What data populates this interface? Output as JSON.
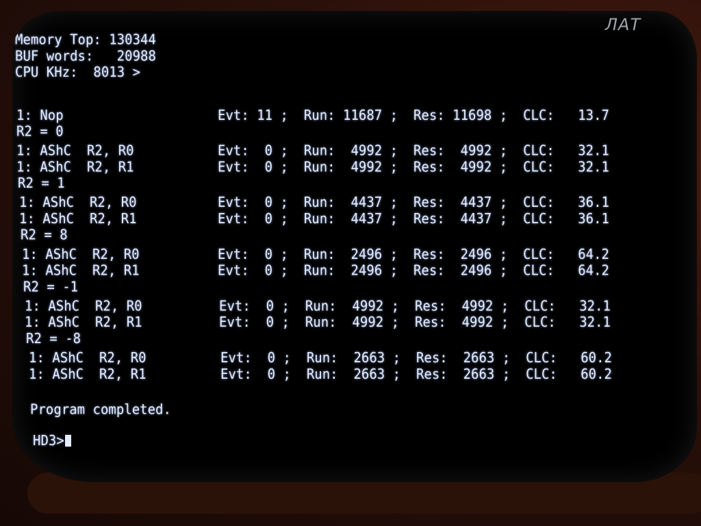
{
  "brand_logo": "ЛАТ",
  "header": {
    "line1": "Memory Top: 130344",
    "line2": "BUF words:   20988",
    "line3": "CPU KHz:  8013 >"
  },
  "rows": [
    {
      "label": "1: Nop",
      "stats": "Evt: 11 ;  Run: 11687 ;  Res: 11698 ;  CLC:   13.7"
    },
    {
      "label": "R2 = 0",
      "stats": ""
    },
    {
      "label": "1: AShC  R2, R0",
      "stats": "Evt:  0 ;  Run:  4992 ;  Res:  4992 ;  CLC:   32.1"
    },
    {
      "label": "1: AShC  R2, R1",
      "stats": "Evt:  0 ;  Run:  4992 ;  Res:  4992 ;  CLC:   32.1"
    },
    {
      "label": "R2 = 1",
      "stats": ""
    },
    {
      "label": "1: AShC  R2, R0",
      "stats": "Evt:  0 ;  Run:  4437 ;  Res:  4437 ;  CLC:   36.1"
    },
    {
      "label": "1: AShC  R2, R1",
      "stats": "Evt:  0 ;  Run:  4437 ;  Res:  4437 ;  CLC:   36.1"
    },
    {
      "label": "R2 = 8",
      "stats": ""
    },
    {
      "label": "1: AShC  R2, R0",
      "stats": "Evt:  0 ;  Run:  2496 ;  Res:  2496 ;  CLC:   64.2"
    },
    {
      "label": "1: AShC  R2, R1",
      "stats": "Evt:  0 ;  Run:  2496 ;  Res:  2496 ;  CLC:   64.2"
    },
    {
      "label": "R2 = -1",
      "stats": ""
    },
    {
      "label": "1: AShC  R2, R0",
      "stats": "Evt:  0 ;  Run:  4992 ;  Res:  4992 ;  CLC:   32.1"
    },
    {
      "label": "1: AShC  R2, R1",
      "stats": "Evt:  0 ;  Run:  4992 ;  Res:  4992 ;  CLC:   32.1"
    },
    {
      "label": "R2 = -8",
      "stats": ""
    },
    {
      "label": "1: AShC  R2, R0",
      "stats": "Evt:  0 ;  Run:  2663 ;  Res:  2663 ;  CLC:   60.2"
    },
    {
      "label": "1: AShC  R2, R1",
      "stats": "Evt:  0 ;  Run:  2663 ;  Res:  2663 ;  CLC:   60.2"
    }
  ],
  "completion_message": "Program completed.",
  "prompt": "HD3>"
}
